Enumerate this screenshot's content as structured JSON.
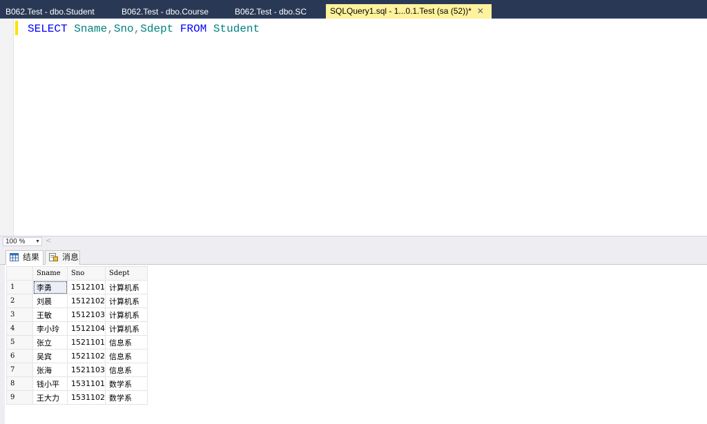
{
  "tabs": [
    {
      "label": "B062.Test - dbo.Student",
      "active": false
    },
    {
      "label": "B062.Test - dbo.Course",
      "active": false
    },
    {
      "label": "B062.Test - dbo.SC",
      "active": false
    },
    {
      "label": "SQLQuery1.sql - 1...0.1.Test (sa (52))*",
      "active": true,
      "close": "✕"
    }
  ],
  "editor": {
    "keywords": {
      "select": "SELECT",
      "from": "FROM"
    },
    "columns": [
      "Sname",
      "Sno",
      "Sdept"
    ],
    "comma": ",",
    "table": "Student"
  },
  "zoom": {
    "value": "100 %",
    "arrow": "▼",
    "scroll_left": "<"
  },
  "result_tabs": [
    {
      "label": "结果",
      "icon": "grid-icon",
      "active": true
    },
    {
      "label": "消息",
      "icon": "messages-icon",
      "active": false
    }
  ],
  "grid": {
    "headers": [
      "Sname",
      "Sno",
      "Sdept"
    ],
    "rows": [
      {
        "n": "1",
        "Sname": "李勇",
        "Sno": "1512101",
        "Sdept": "计算机系"
      },
      {
        "n": "2",
        "Sname": "刘晨",
        "Sno": "1512102",
        "Sdept": "计算机系"
      },
      {
        "n": "3",
        "Sname": "王敏",
        "Sno": "1512103",
        "Sdept": "计算机系"
      },
      {
        "n": "4",
        "Sname": "李小玲",
        "Sno": "1512104",
        "Sdept": "计算机系"
      },
      {
        "n": "5",
        "Sname": "张立",
        "Sno": "1521101",
        "Sdept": "信息系"
      },
      {
        "n": "6",
        "Sname": "吴宾",
        "Sno": "1521102",
        "Sdept": "信息系"
      },
      {
        "n": "7",
        "Sname": "张海",
        "Sno": "1521103",
        "Sdept": "信息系"
      },
      {
        "n": "8",
        "Sname": "钱小平",
        "Sno": "1531101",
        "Sdept": "数学系"
      },
      {
        "n": "9",
        "Sname": "王大力",
        "Sno": "1531102",
        "Sdept": "数学系"
      }
    ]
  },
  "colors": {
    "tab_strip": "#293955",
    "active_tab": "#fff29d",
    "keyword": "#0000ff",
    "identifier": "#008080",
    "change_marker": "#fce100"
  }
}
